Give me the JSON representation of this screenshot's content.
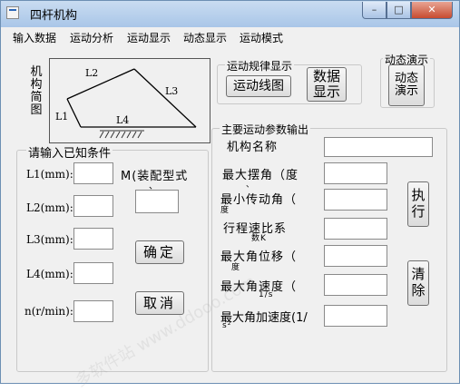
{
  "window": {
    "title": "四杆机构",
    "controls": {
      "minimize": "–",
      "maximize": "□",
      "close": "✕"
    }
  },
  "menu": [
    "输入数据",
    "运动分析",
    "运动显示",
    "动态显示",
    "运动模式"
  ],
  "diagram": {
    "side_label": "机构简图",
    "link_labels": {
      "l1": "L1",
      "l2": "L2",
      "l3": "L3",
      "l4": "L4"
    }
  },
  "motion_display": {
    "title": "运动规律显示",
    "line_button": "运动线图",
    "data_button": "数据\n显示"
  },
  "dynamic_demo": {
    "title": "动态演示",
    "button": "动态\n演示"
  },
  "input_group": {
    "title": "请输入已知条件",
    "fields": [
      {
        "label": "L1(mm):",
        "value": ""
      },
      {
        "label": "L2(mm):",
        "value": ""
      },
      {
        "label": "L3(mm):",
        "value": ""
      },
      {
        "label": "L4(mm):",
        "value": ""
      },
      {
        "label": "n(r/min):",
        "value": ""
      }
    ],
    "mode_label": "M(装配型式",
    "mode_suffix": "、",
    "mode_value": "",
    "confirm_button": "确定",
    "cancel_button": "取消"
  },
  "output_group": {
    "title": "主要运动参数输出",
    "rows": [
      {
        "label": "机构名称",
        "sub": "",
        "value": ""
      },
      {
        "label": "最大摆角（度",
        "sub": "、",
        "value": ""
      },
      {
        "label": "最小传动角（",
        "sub": "度",
        "value": ""
      },
      {
        "label": "行程速比系",
        "sub": "数K",
        "value": ""
      },
      {
        "label": "最大角位移（",
        "sub": "度",
        "value": ""
      },
      {
        "label": "最大角速度（",
        "sub": "1/s",
        "value": ""
      },
      {
        "label": "最大角加速度(1/",
        "sub": "s²",
        "value": ""
      }
    ],
    "execute_button": "执\n行",
    "clear_button": "清\n除"
  },
  "watermark": {
    "text": "多软件站 www.ddooo.com"
  }
}
